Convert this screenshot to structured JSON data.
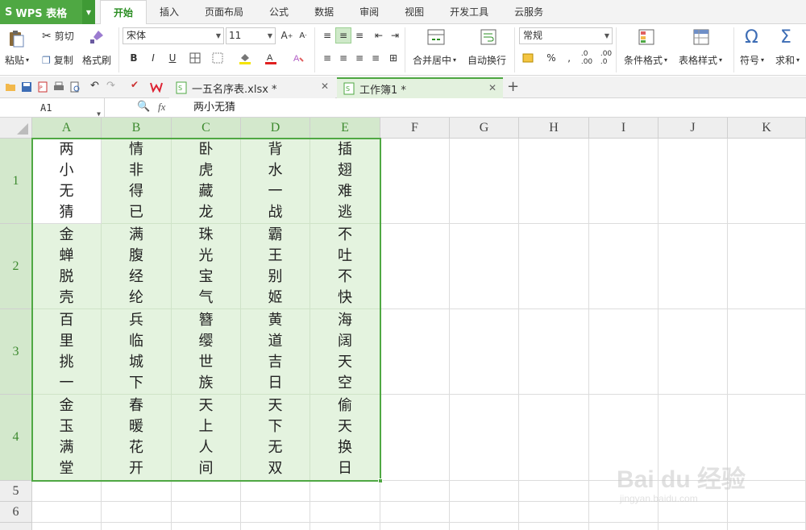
{
  "app": {
    "logo": "S",
    "name": "WPS 表格"
  },
  "menu": {
    "tabs": [
      "开始",
      "插入",
      "页面布局",
      "公式",
      "数据",
      "审阅",
      "视图",
      "开发工具",
      "云服务"
    ],
    "active_index": 0
  },
  "ribbon": {
    "paste_label": "粘贴",
    "cut_label": "剪切",
    "copy_label": "复制",
    "format_painter_label": "格式刷",
    "font_name": "宋体",
    "font_size": "11",
    "bold": "B",
    "italic": "I",
    "underline": "U",
    "merge_center_label": "合并居中",
    "wrap_label": "自动换行",
    "number_format": "常规",
    "percent": "%",
    "comma": "‚",
    "cond_format_label": "条件格式",
    "table_style_label": "表格样式",
    "symbol_label": "符号",
    "sum_label": "求和",
    "omega": "Ω",
    "sigma": "Σ"
  },
  "doc_tabs": [
    {
      "label": "一五名序表.xlsx *",
      "active": false
    },
    {
      "label": "工作簿1 *",
      "active": true
    }
  ],
  "formula_bar": {
    "cell_ref": "A1",
    "fx": "fx",
    "content": "两小无猜"
  },
  "columns": [
    "A",
    "B",
    "C",
    "D",
    "E",
    "F",
    "G",
    "H",
    "I",
    "J",
    "K"
  ],
  "rows": [
    "1",
    "2",
    "3",
    "4",
    "5",
    "6"
  ],
  "cells": [
    [
      "两小无猜",
      "情非得已",
      "卧虎藏龙",
      "背水一战",
      "插翅难逃"
    ],
    [
      "金蝉脱壳",
      "满腹经纶",
      "珠光宝气",
      "霸王别姬",
      "不吐不快"
    ],
    [
      "百里挑一",
      "兵临城下",
      "簪缨世族",
      "黄道吉日",
      "海阔天空"
    ],
    [
      "金玉满堂",
      "春暖花开",
      "天上人间",
      "天下无双",
      "偷天换日"
    ]
  ],
  "watermark": {
    "brand": "Bai du 经验",
    "url": "jingyan.baidu.com"
  },
  "colors": {
    "accent": "#4fa843",
    "selection": "#e4f3df"
  }
}
